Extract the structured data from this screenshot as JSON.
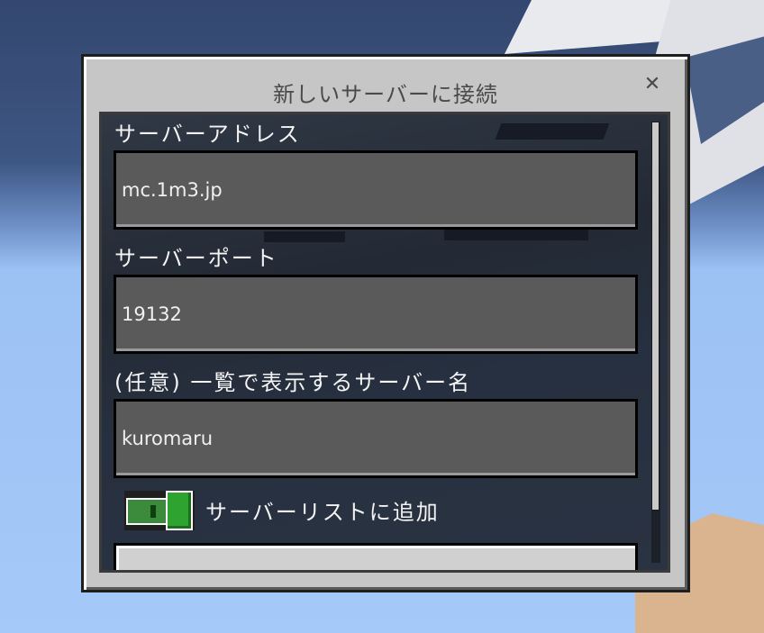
{
  "dialog": {
    "title": "新しいサーバーに接続",
    "close_glyph": "✕"
  },
  "fields": {
    "address": {
      "label": "サーバーアドレス",
      "value": "mc.1m3.jp"
    },
    "port": {
      "label": "サーバーポート",
      "value": "19132"
    },
    "name": {
      "label": "(任意) 一覧で表示するサーバー名",
      "value": "kuromaru"
    }
  },
  "toggle": {
    "label": "サーバーリストに追加",
    "on": true,
    "color": "#2fa32f"
  },
  "icons": [
    "close-icon"
  ],
  "colors": {
    "dialog_bg": "#c6c6c6",
    "panel_bg": "#232a35",
    "field_bg": "#5a5a5a"
  }
}
